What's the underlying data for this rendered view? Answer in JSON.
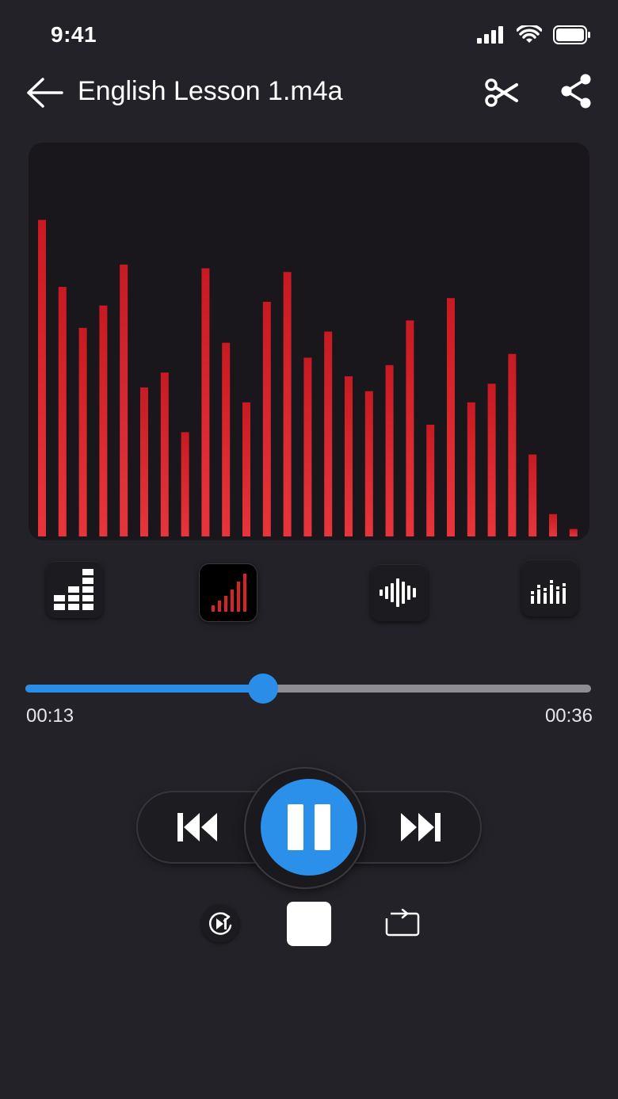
{
  "status_bar": {
    "time": "9:41"
  },
  "header": {
    "title": "English Lesson 1.m4a"
  },
  "visualizer": {
    "bar_levels": [
      0.85,
      0.67,
      0.56,
      0.62,
      0.73,
      0.4,
      0.44,
      0.28,
      0.72,
      0.52,
      0.36,
      0.63,
      0.71,
      0.48,
      0.55,
      0.43,
      0.39,
      0.46,
      0.58,
      0.3,
      0.64,
      0.36,
      0.41,
      0.49,
      0.22,
      0.06,
      0.02
    ],
    "bar_color": "#e02a30"
  },
  "modes": [
    {
      "name": "blocks-mode",
      "active": false
    },
    {
      "name": "rising-bars-mode",
      "active": true
    },
    {
      "name": "waveform-mode",
      "active": false
    },
    {
      "name": "dots-bars-mode",
      "active": false
    }
  ],
  "progress": {
    "current": "00:13",
    "total": "00:36",
    "fraction": 0.42
  },
  "colors": {
    "accent": "#2a8de8",
    "background": "#232228"
  }
}
